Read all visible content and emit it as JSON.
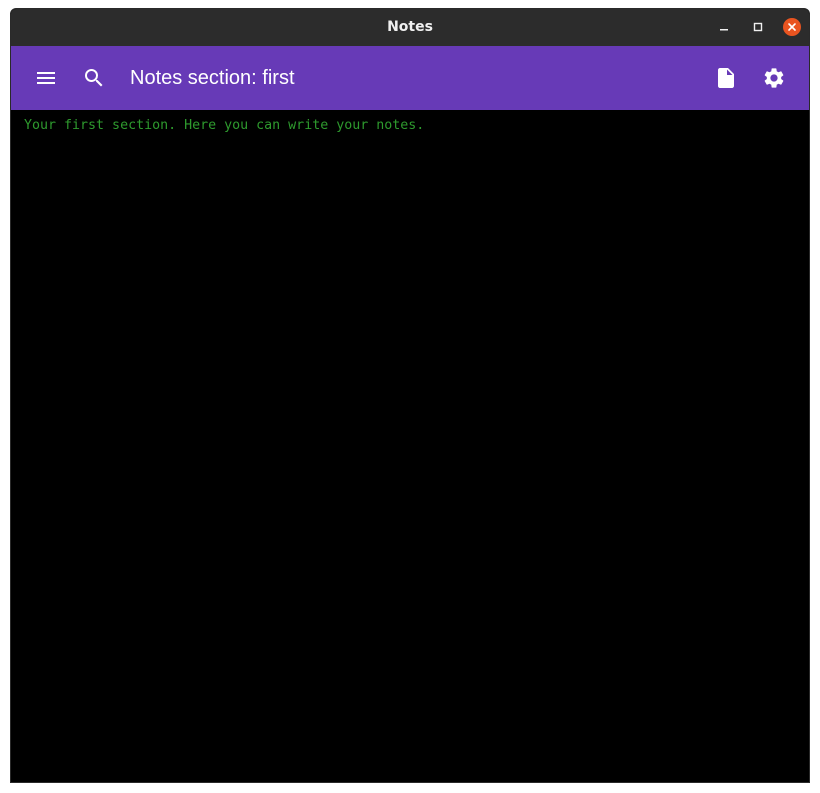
{
  "window": {
    "title": "Notes"
  },
  "toolbar": {
    "title": "Notes section: first",
    "menu_icon": "menu-icon",
    "search_icon": "search-icon",
    "file_icon": "file-icon",
    "settings_icon": "gear-icon"
  },
  "editor": {
    "content": "Your first section. Here you can write your notes."
  },
  "colors": {
    "titlebar": "#2c2c2c",
    "toolbar": "#673ab7",
    "editor_bg": "#000000",
    "editor_text": "#2e9a2e",
    "close_button": "#e95420"
  }
}
